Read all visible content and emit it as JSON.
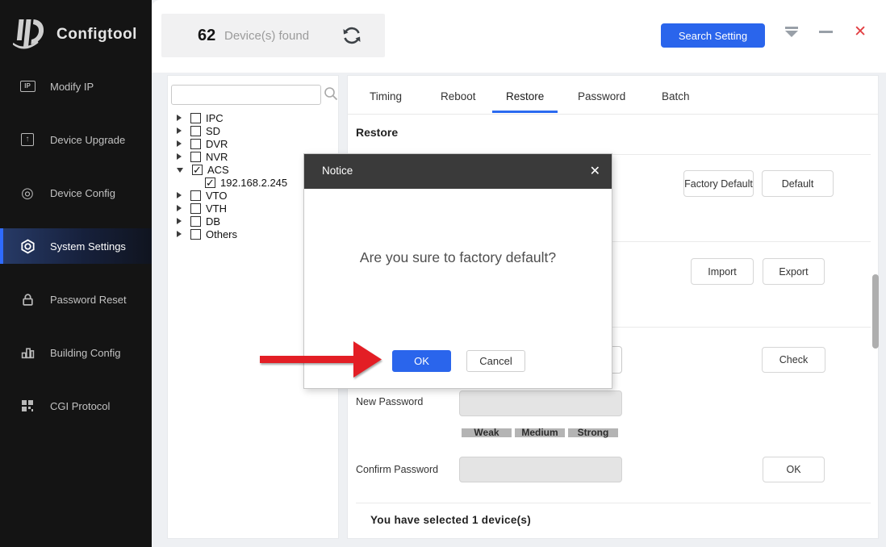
{
  "app": {
    "title": "Configtool"
  },
  "sidebar": {
    "items": [
      {
        "icon": "modify-ip-icon",
        "icon_text": "IP",
        "label": "Modify IP",
        "active": false
      },
      {
        "icon": "device-upgrade-icon",
        "icon_text": "↑",
        "label": "Device Upgrade",
        "active": false
      },
      {
        "icon": "device-config-icon",
        "icon_text": "◎",
        "label": "Device Config",
        "active": false
      },
      {
        "icon": "system-settings-icon",
        "label": "System Settings",
        "active": true
      },
      {
        "icon": "password-reset-icon",
        "label": "Password Reset",
        "active": false
      },
      {
        "icon": "building-config-icon",
        "label": "Building Config",
        "active": false
      },
      {
        "icon": "cgi-protocol-icon",
        "label": "CGI Protocol",
        "active": false
      }
    ]
  },
  "topbar": {
    "device_count": "62",
    "device_count_label": "Device(s) found",
    "search_setting_label": "Search Setting",
    "close_glyph": "✕"
  },
  "device_tree": {
    "search_value": "",
    "groups": [
      {
        "label": "IPC",
        "checked": false
      },
      {
        "label": "SD",
        "checked": false
      },
      {
        "label": "DVR",
        "checked": false
      },
      {
        "label": "NVR",
        "checked": false
      },
      {
        "label": "ACS",
        "checked": true,
        "expanded": true,
        "children": [
          {
            "label": "192.168.2.245",
            "checked": true
          }
        ]
      },
      {
        "label": "VTO",
        "checked": false
      },
      {
        "label": "VTH",
        "checked": false
      },
      {
        "label": "DB",
        "checked": false
      },
      {
        "label": "Others",
        "checked": false
      }
    ]
  },
  "tabs": {
    "items": [
      {
        "label": "Timing"
      },
      {
        "label": "Reboot"
      },
      {
        "label": "Restore",
        "active": true
      },
      {
        "label": "Password"
      },
      {
        "label": "Batch"
      }
    ],
    "active": "Restore"
  },
  "restore_section": {
    "title": "Restore",
    "factory_default_label": "Factory Default",
    "default_label": "Default",
    "import_label": "Import",
    "export_label": "Export",
    "check_label": "Check",
    "new_password_label": "New Password",
    "strength": [
      "Weak",
      "Medium",
      "Strong"
    ],
    "confirm_password_label": "Confirm Password",
    "ok_label": "OK",
    "footer": "You have selected 1 device(s)"
  },
  "dialog": {
    "title": "Notice",
    "message": "Are you sure to factory default?",
    "ok_label": "OK",
    "cancel_label": "Cancel",
    "close_glyph": "✕"
  },
  "colors": {
    "accent_blue": "#2a65ec",
    "tab_underline_blue": "#2b6af0",
    "close_red": "#e23e42",
    "arrow_red": "#e31e25",
    "sidebar_bg": "#141414",
    "dialog_header": "#3a3a3a"
  }
}
